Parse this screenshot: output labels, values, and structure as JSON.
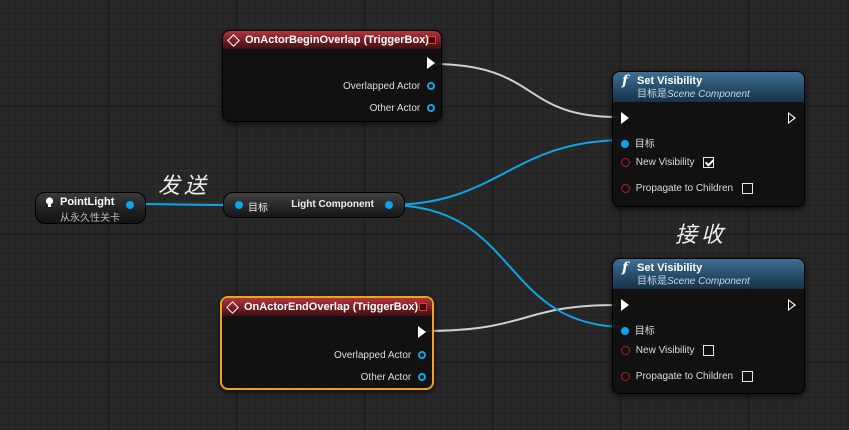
{
  "graph": {
    "begin_overlap_node": {
      "title": "OnActorBeginOverlap (TriggerBox)",
      "pins": [
        "Overlapped Actor",
        "Other Actor"
      ]
    },
    "end_overlap_node": {
      "title": "OnActorEndOverlap (TriggerBox)",
      "pins": [
        "Overlapped Actor",
        "Other Actor"
      ]
    },
    "set_visibility_top": {
      "glyph": "f",
      "title": "Set Visibility",
      "target_prefix": "目标是",
      "target_class": "Scene Component",
      "target_pin": "目标",
      "new_visibility_label": "New Visibility",
      "new_visibility_checked": true,
      "propagate_label": "Propagate to Children",
      "propagate_checked": false
    },
    "set_visibility_bottom": {
      "glyph": "f",
      "title": "Set Visibility",
      "target_prefix": "目标是",
      "target_class": "Scene Component",
      "target_pin": "目标",
      "new_visibility_label": "New Visibility",
      "new_visibility_checked": false,
      "propagate_label": "Propagate to Children",
      "propagate_checked": false
    },
    "point_light_node": {
      "title": "PointLight",
      "subtitle": "从永久性关卡"
    },
    "getter_node": {
      "target_pin": "目标",
      "output_label": "Light Component"
    },
    "annotations": {
      "send": "发送",
      "receive": "接收"
    }
  },
  "colors": {
    "background": "#262626",
    "event_header": "#9c2a30",
    "function_header": "#2f5d80",
    "object_pin": "#0ea4e8",
    "bool_pin": "#b81d1d",
    "exec_wire": "#d0d0d0",
    "selection": "#f2a11c"
  }
}
